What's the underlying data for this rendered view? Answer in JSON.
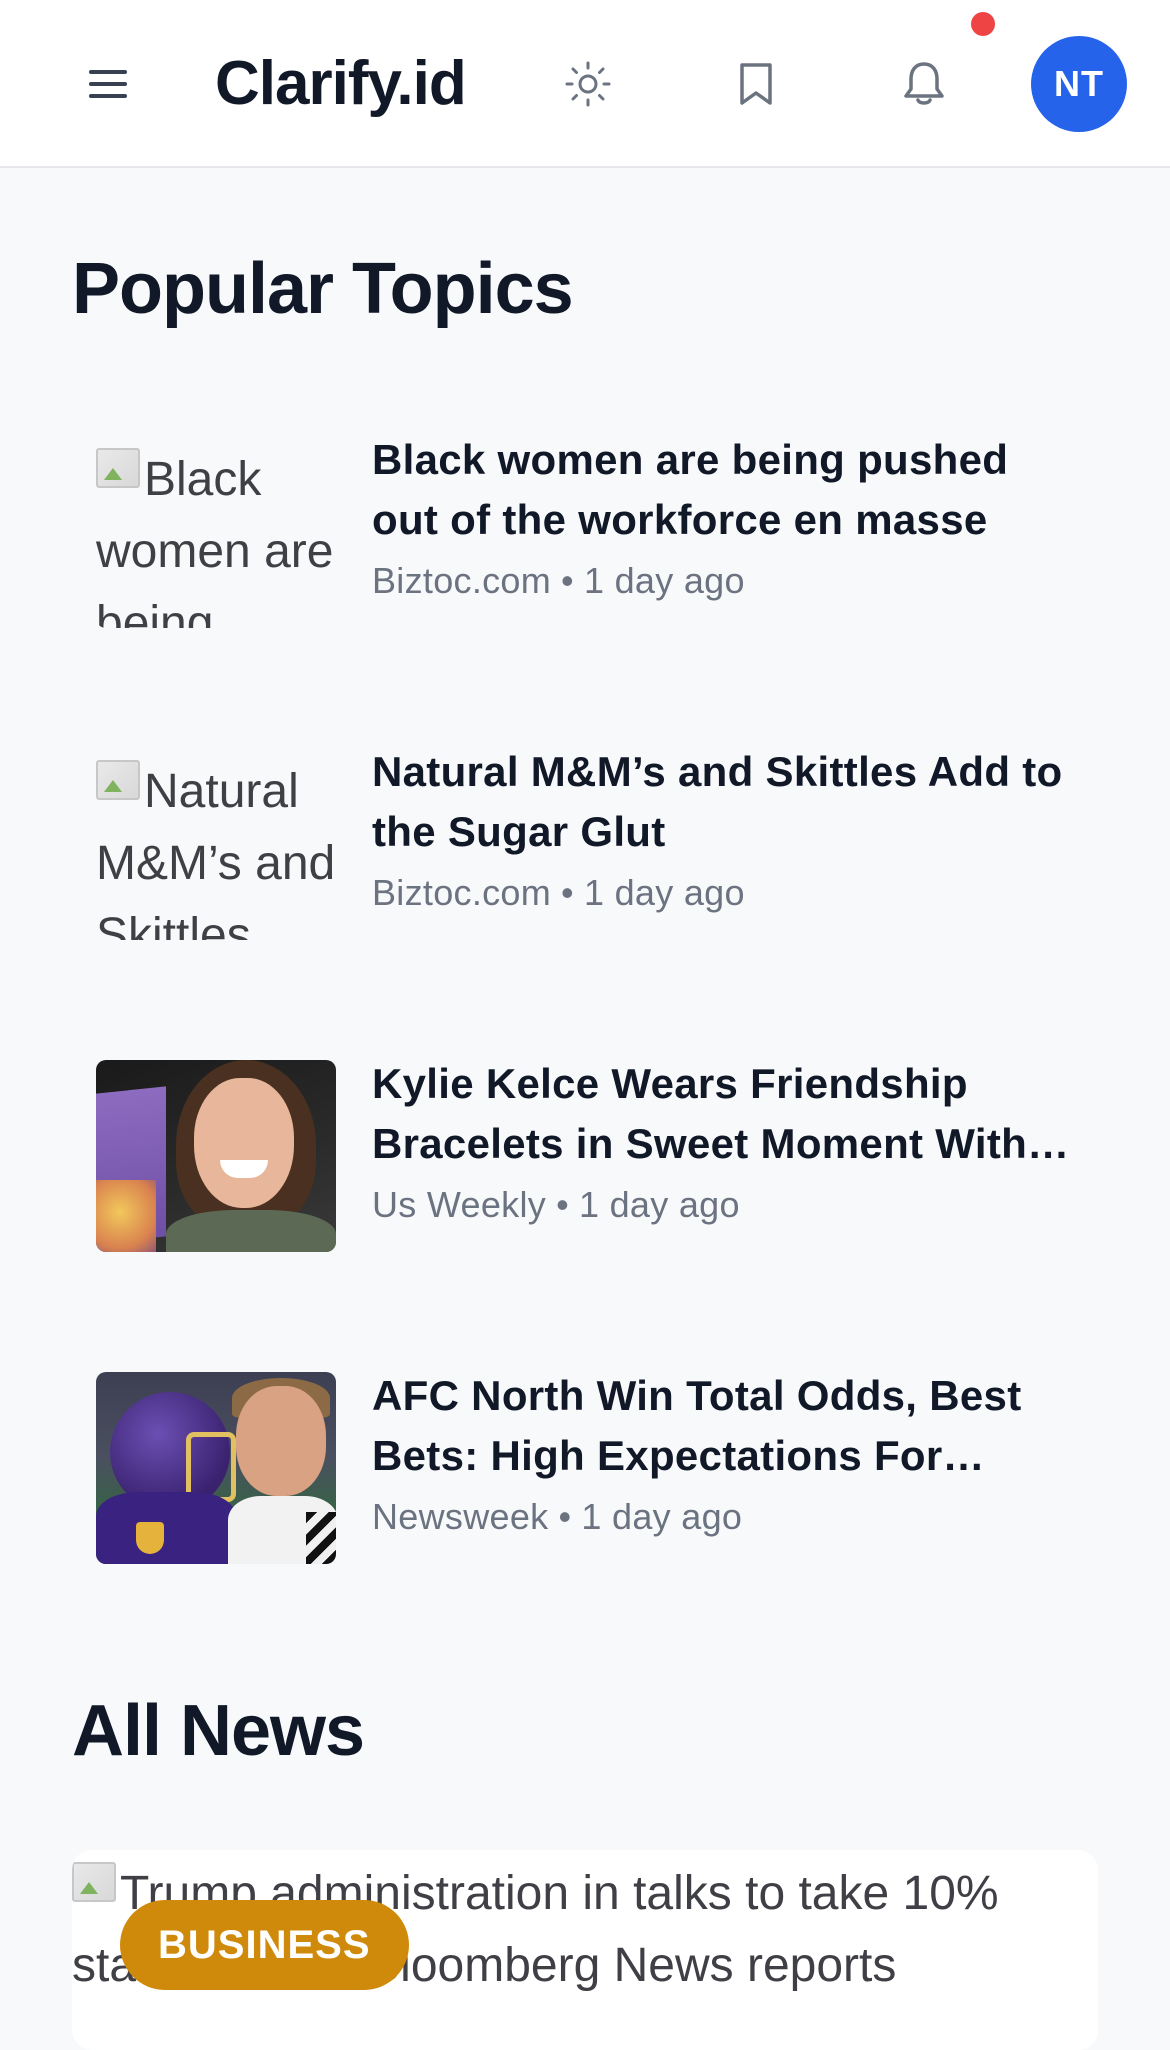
{
  "header": {
    "logo": "Clarify.id",
    "avatar_initials": "NT",
    "icons": {
      "menu": "menu-icon",
      "theme": "sun-icon",
      "bookmark": "bookmark-icon",
      "notifications": "bell-icon"
    },
    "colors": {
      "avatar_bg": "#2563EB",
      "notification_dot": "#EF4444"
    }
  },
  "popular": {
    "title": "Popular Topics",
    "items": [
      {
        "image_alt": "Black women are being",
        "title": "Black women are being pushed out of the workforce en masse",
        "source": "Biztoc.com",
        "time": "1 day ago"
      },
      {
        "image_alt": "Natural M&M’s and Skittles",
        "title": "Natural M&M’s and Skittles Add to the Sugar Glut",
        "source": "Biztoc.com",
        "time": "1 day ago"
      },
      {
        "image_alt": "",
        "title": "Kylie Kelce Wears Friendship Bracelets in Sweet Moment With Her Daughters",
        "source": "Us Weekly",
        "time": "1 day ago"
      },
      {
        "image_alt": "",
        "title": "AFC North Win Total Odds, Best Bets: High Expectations For Ravens and Bengals",
        "source": "Newsweek",
        "time": "1 day ago"
      }
    ],
    "separator": "•"
  },
  "all_news": {
    "title": "All News",
    "card": {
      "image_alt": "Trump administration in talks to take 10% stake in Intel, Bloomberg News reports",
      "category": "BUSINESS",
      "category_color": "#D08A0B"
    }
  }
}
